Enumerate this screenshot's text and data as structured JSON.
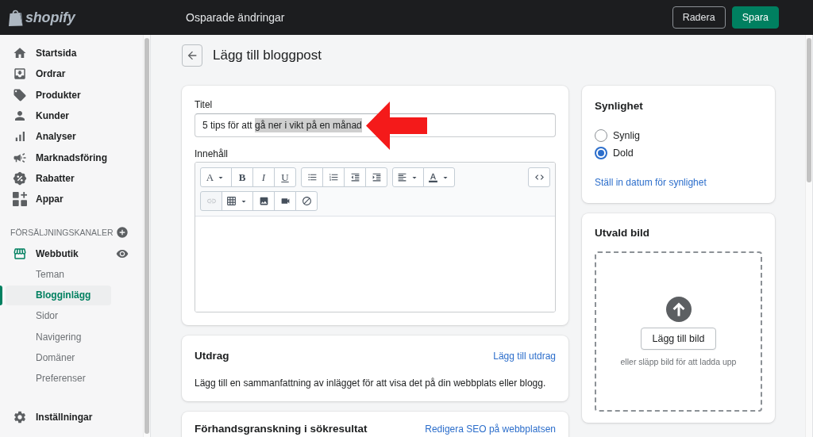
{
  "top_bar": {
    "logo": "shopify",
    "status": "Osparade ändringar",
    "buttons": [
      {
        "label": "Radera",
        "kind": "secondary"
      },
      {
        "label": "Spara",
        "kind": "primary"
      }
    ]
  },
  "sidebar": {
    "items": [
      {
        "label": "Startsida",
        "selected": false
      },
      {
        "label": "Ordrar",
        "selected": false
      },
      {
        "label": "Produkter",
        "selected": false
      },
      {
        "label": "Kunder",
        "selected": false
      },
      {
        "label": "Analyser",
        "selected": false
      },
      {
        "label": "Marknadsföring",
        "selected": false
      },
      {
        "label": "Rabatter",
        "selected": false
      },
      {
        "label": "Appar",
        "selected": false
      }
    ],
    "sales_channels": {
      "heading": "FÖRSÄLJNINGSKANALER",
      "channels": [
        {
          "label": "Webbutik",
          "selected": false,
          "children": [
            {
              "label": "Teman",
              "selected": false
            },
            {
              "label": "Blogginlägg",
              "selected": true
            },
            {
              "label": "Sidor",
              "selected": false
            },
            {
              "label": "Navigering",
              "selected": false
            },
            {
              "label": "Domäner",
              "selected": false
            },
            {
              "label": "Preferenser",
              "selected": false
            }
          ]
        }
      ]
    },
    "footer_item": {
      "label": "Inställningar",
      "selected": false
    }
  },
  "page": {
    "title": "Lägg till bloggpost"
  },
  "post_card": {
    "title_field": {
      "label": "Titel",
      "value_parts": [
        {
          "text": "5 tips för att ",
          "selected": false
        },
        {
          "text": "gå ner i vikt på en månad",
          "selected": true
        }
      ]
    },
    "content_editor": {
      "label": "Innehåll",
      "toolbar_rows": [
        {
          "groups": [
            [
              {
                "kind": "font",
                "label": "A",
                "dropdown": true,
                "disabled": false
              },
              {
                "kind": "bold",
                "label": "B",
                "disabled": false
              },
              {
                "kind": "italic",
                "label": "I",
                "disabled": false
              },
              {
                "kind": "underline",
                "label": "U",
                "disabled": false
              }
            ],
            [
              {
                "kind": "bullet-list",
                "disabled": false
              },
              {
                "kind": "numbered-list",
                "disabled": false
              },
              {
                "kind": "outdent",
                "disabled": false
              },
              {
                "kind": "indent",
                "disabled": false
              }
            ],
            [
              {
                "kind": "align",
                "dropdown": true,
                "disabled": false
              },
              {
                "kind": "text-color",
                "dropdown": true,
                "disabled": false
              }
            ]
          ],
          "end_groups": [
            [
              {
                "kind": "code",
                "disabled": false
              }
            ]
          ]
        },
        {
          "groups": [
            [
              {
                "kind": "link",
                "disabled": true
              },
              {
                "kind": "table",
                "dropdown": true,
                "disabled": false
              },
              {
                "kind": "image",
                "disabled": false
              },
              {
                "kind": "video",
                "disabled": false
              },
              {
                "kind": "clear-format",
                "disabled": false
              }
            ]
          ]
        }
      ]
    }
  },
  "excerpt_card": {
    "heading": "Utdrag",
    "action": "Lägg till utdrag",
    "description": "Lägg till en sammanfattning av inlägget för att visa det på din webbplats eller blogg."
  },
  "seo_card": {
    "heading": "Förhandsgranskning i sökresultat",
    "action": "Redigera SEO på webbplatsen"
  },
  "visibility_card": {
    "heading": "Synlighet",
    "options": [
      {
        "label": "Synlig",
        "selected": false
      },
      {
        "label": "Dold",
        "selected": true
      }
    ],
    "link": "Ställ in datum för synlighet"
  },
  "image_card": {
    "heading": "Utvald bild",
    "button": "Lägg till bild",
    "hint": "eller släpp bild för att ladda upp"
  }
}
